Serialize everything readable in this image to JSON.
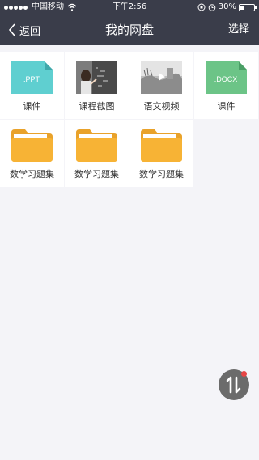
{
  "status_bar": {
    "carrier": "中国移动",
    "time": "下午2:56",
    "battery_text": "30%",
    "battery_level": 0.3
  },
  "nav": {
    "back_label": "返回",
    "title": "我的网盘",
    "select_label": "选择"
  },
  "files": [
    {
      "label": "课件",
      "type": "ppt",
      "badge": ".PPT",
      "color": "#5fcfd0"
    },
    {
      "label": "课程截图",
      "type": "image"
    },
    {
      "label": "语文视频",
      "type": "video"
    },
    {
      "label": "课件",
      "type": "docx",
      "badge": ".DOCX",
      "color": "#6cc487"
    },
    {
      "label": "数学习题集",
      "type": "folder",
      "color": "#f7b335"
    },
    {
      "label": "数学习题集",
      "type": "folder",
      "color": "#f7b335"
    },
    {
      "label": "数学习题集",
      "type": "folder",
      "color": "#f7b335"
    }
  ]
}
